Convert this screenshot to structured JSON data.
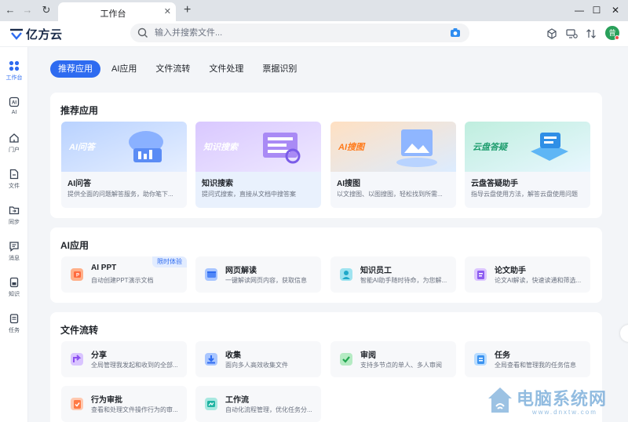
{
  "browser": {
    "tab_title": "工作台"
  },
  "header": {
    "brand": "亿方云",
    "search_placeholder": "输入并搜索文件...",
    "avatar_text": "曾"
  },
  "sidebar": {
    "items": [
      {
        "label": "工作台",
        "icon": "grid-icon",
        "active": true
      },
      {
        "label": "AI",
        "icon": "ai-icon"
      },
      {
        "label": "门户",
        "icon": "home-icon"
      },
      {
        "label": "文件",
        "icon": "file-icon"
      },
      {
        "label": "同步",
        "icon": "sync-folder-icon"
      },
      {
        "label": "消息",
        "icon": "message-icon"
      },
      {
        "label": "知识",
        "icon": "knowledge-icon"
      },
      {
        "label": "任务",
        "icon": "task-icon"
      }
    ]
  },
  "tabs": [
    "推荐应用",
    "AI应用",
    "文件流转",
    "文件处理",
    "票据识别"
  ],
  "recommended": {
    "title": "推荐应用",
    "items": [
      {
        "badge": "AI问答",
        "name": "AI问答",
        "desc": "提供全面的问题解答服务，助你笔下..."
      },
      {
        "badge": "知识搜索",
        "name": "知识搜索",
        "desc": "提问式搜索，直接从文档中搜答案"
      },
      {
        "badge": "AI搜图",
        "name": "AI搜图",
        "desc": "以文搜图、以图搜图，轻松找到所需..."
      },
      {
        "badge": "云盘答疑",
        "name": "云盘答疑助手",
        "desc": "指导云盘使用方法，解答云盘使用问题"
      }
    ]
  },
  "ai_apps": {
    "title": "AI应用",
    "items": [
      {
        "name": "AI PPT",
        "desc": "自动创建PPT演示文档",
        "tag": "限时体验",
        "icon": "ppt-icon"
      },
      {
        "name": "网页解读",
        "desc": "一键解读网页内容，获取信息",
        "icon": "webpage-icon"
      },
      {
        "name": "知识员工",
        "desc": "智能AI助手随时待命，为您解...",
        "icon": "employee-icon"
      },
      {
        "name": "论文助手",
        "desc": "论文AI解读，快速读通和筛选...",
        "icon": "paper-icon"
      }
    ]
  },
  "file_flow": {
    "title": "文件流转",
    "items": [
      {
        "name": "分享",
        "desc": "全局管理我发起和收到的全部...",
        "icon": "share-icon"
      },
      {
        "name": "收集",
        "desc": "面向多人高效收集文件",
        "icon": "collect-icon"
      },
      {
        "name": "审阅",
        "desc": "支持多节点的单人、多人审阅",
        "icon": "review-icon"
      },
      {
        "name": "任务",
        "desc": "全局查看和管理我的任务信息",
        "icon": "task-icon"
      },
      {
        "name": "行为审批",
        "desc": "查看和处理文件操作行为的审...",
        "icon": "approval-icon"
      },
      {
        "name": "工作流",
        "desc": "自动化流程管理，优化任务分...",
        "icon": "workflow-icon"
      }
    ]
  },
  "watermark": {
    "text": "电脑系统网",
    "sub": "www.dnxtw.com"
  },
  "colors": {
    "accent": "#2e6bf0",
    "page_bg": "#f3f5f8",
    "card_bg": "#ffffff"
  }
}
